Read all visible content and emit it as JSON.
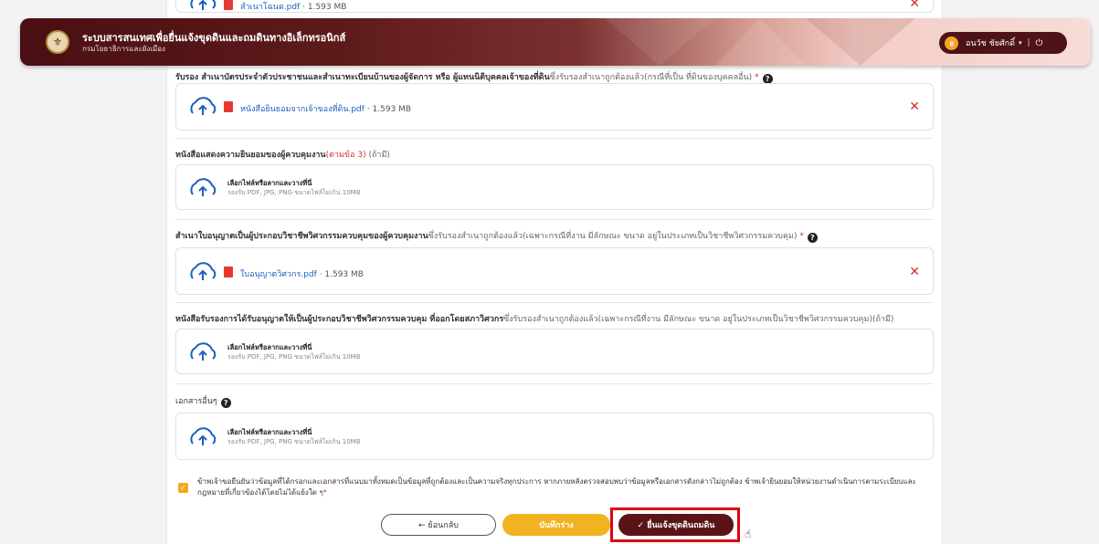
{
  "header": {
    "title": "ระบบสารสนเทศเพื่อยื่นแจ้งขุดดินและถมดินทางอิเล็กทรอนิกส์",
    "subtitle": "กรมโยธาธิการและผังเมือง",
    "user_initial": "อ",
    "user_name": "อนวัช ชัยศักดิ์",
    "caret": "▾",
    "separator": "|",
    "power_icon": "⏻",
    "brand_color": "#4a0f13"
  },
  "top_file": {
    "name": "สำเนาโฉนด.pdf",
    "size": "· 1.593 MB"
  },
  "sections": {
    "s1": {
      "label_bold": "รับรอง สำเนาบัตรประจำตัวประชาชนและสำเนาทะเบียนบ้านของผู้จัดการ หรือ ผู้แทนนิติบุคคลเจ้าของที่ดิน",
      "label_note": "ซึ่งรับรองสำเนาถูกต้องแล้ว(กรณีที่เป็น ที่ดินของบุคคลอื่น)",
      "required": " *",
      "file_name": "หนังสือยินยอมจากเจ้าของที่ดิน.pdf",
      "file_size": "· 1.593 MB"
    },
    "s2": {
      "label_bold": "หนังสือแสดงความยินยอมของผู้ควบคุมงาน",
      "label_note_red": "(ตามข้อ 3)",
      "label_note": " (ถ้ามี)",
      "choose": "เลือกไฟล์หรือลากและวางที่นี่",
      "hint": "รองรับ PDF, JPG, PNG ขนาดไฟล์ไม่เกิน 10MB"
    },
    "s3": {
      "label_bold": "สำเนาใบอนุญาตเป็นผู้ประกอบวิชาชีพวิศวกรรมควบคุมของผู้ควบคุมงาน",
      "label_note": "ซึ่งรับรองสำเนาถูกต้องแล้ว(เฉพาะกรณีที่งาน มีลักษณะ ขนาด อยู่ในประเภทเป็นวิชาชีพวิศวกรรมควบคุม)",
      "required": " *",
      "file_name": "ใบอนุญาตวิศวกร.pdf",
      "file_size": "· 1.593 MB"
    },
    "s4": {
      "label_bold": "หนังสือรับรองการได้รับอนุญาตให้เป็นผู้ประกอบวิชาชีพวิศวกรรมควบคุม ที่ออกโดยสภาวิศวกร",
      "label_note": "ซึ่งรับรองสำเนาถูกต้องแล้ว(เฉพาะกรณีที่งาน มีลักษณะ ขนาด อยู่ในประเภทเป็นวิชาชีพวิศวกรรมควบคุม)(ถ้ามี)",
      "choose": "เลือกไฟล์หรือลากและวางที่นี่",
      "hint": "รองรับ PDF, JPG, PNG ขนาดไฟล์ไม่เกิน 10MB"
    },
    "s5": {
      "label": "เอกสารอื่นๆ",
      "choose": "เลือกไฟล์หรือลากและวางที่นี่",
      "hint": "รองรับ PDF, JPG, PNG ขนาดไฟล์ไม่เกิน 10MB"
    }
  },
  "consent": {
    "check": "✓",
    "text": "ข้าพเจ้าขอยืนยันว่าข้อมูลที่ได้กรอกและเอกสารที่แนบมาทั้งหมดเป็นข้อมูลที่ถูกต้องและเป็นความจริงทุกประการ หากภายหลังตรวจสอบพบว่าข้อมูลหรือเอกสารดังกล่าวไม่ถูกต้อง ข้าพเจ้ายินยอมให้หน่วยงานดำเนินการตามระเบียบและกฎหมายที่เกี่ยวข้องได้โดยไม่ได้แย้งใด ๆ",
    "required": "*"
  },
  "buttons": {
    "back": "← ย้อนกลับ",
    "draft": "บันทึกร่าง",
    "submit": "✓  ยื่นแจ้งขุดดินถมดิน"
  },
  "help_mark": "?",
  "remove_mark": "✕",
  "cursor": "☝"
}
